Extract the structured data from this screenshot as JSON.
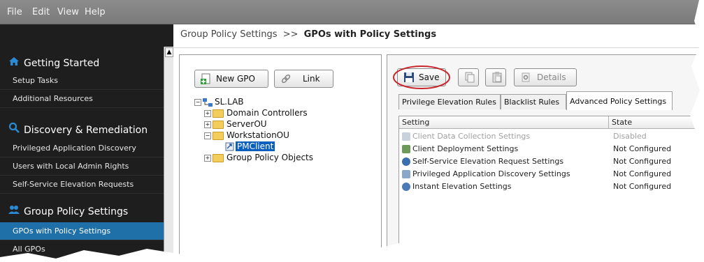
{
  "menu": [
    "File",
    "Edit",
    "View",
    "Help"
  ],
  "sidebar": {
    "sections": [
      {
        "title": "Getting Started",
        "icon": "home-icon",
        "items": [
          "Setup Tasks",
          "Additional Resources"
        ]
      },
      {
        "title": "Discovery & Remediation",
        "icon": "search-icon",
        "items": [
          "Privileged Application Discovery",
          "Users with Local Admin Rights",
          "Self-Service Elevation Requests"
        ]
      },
      {
        "title": "Group Policy Settings",
        "icon": "users-icon",
        "items": [
          "GPOs with Policy Settings",
          "All GPOs"
        ]
      }
    ],
    "active_item": "GPOs with Policy Settings"
  },
  "breadcrumb": {
    "parent": "Group Policy Settings",
    "separator": ">>",
    "current": "GPOs with Policy Settings"
  },
  "left_toolbar": {
    "new_gpo": "New GPO",
    "link": "Link"
  },
  "tree": {
    "root": "SL.LAB",
    "children": [
      "Domain Controllers",
      "ServerOU",
      "WorkstationOU",
      "Group Policy Objects"
    ],
    "selected": "PMClient"
  },
  "right_toolbar": {
    "save": "Save",
    "details": "Details"
  },
  "tabs": [
    "Privilege Elevation Rules",
    "Blacklist Rules",
    "Advanced Policy Settings"
  ],
  "active_tab": "Advanced Policy Settings",
  "grid": {
    "columns": [
      "Setting",
      "State"
    ],
    "rows": [
      {
        "setting": "Client Data Collection Settings",
        "state": "Disabled",
        "disabled": true
      },
      {
        "setting": "Client Deployment Settings",
        "state": "Not Configured"
      },
      {
        "setting": "Self-Service Elevation Request Settings",
        "state": "Not Configured"
      },
      {
        "setting": "Privileged Application Discovery Settings",
        "state": "Not Configured"
      },
      {
        "setting": "Instant Elevation Settings",
        "state": "Not Configured"
      }
    ]
  },
  "colors": {
    "accent": "#1f6fa8",
    "selection": "#0a5fbe",
    "highlight_ring": "#c8262c",
    "sidebar_bg": "#1e1e1e"
  }
}
